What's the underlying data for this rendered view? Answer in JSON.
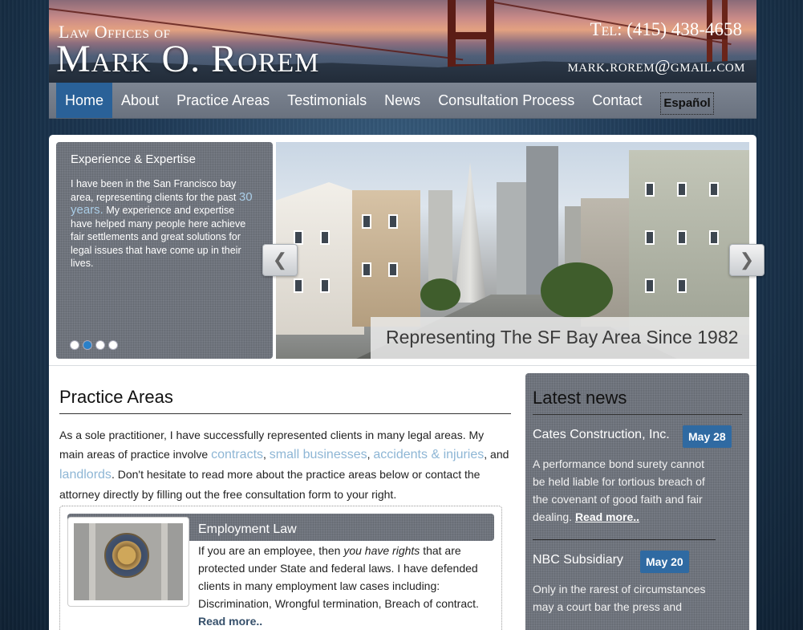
{
  "header": {
    "brand_top": "Law Offices of",
    "brand_name": "Mark O. Rorem",
    "phone": "Tel: (415) 438-4658",
    "email": "mark.rorem@gmail.com"
  },
  "nav": {
    "items": [
      {
        "label": "Home",
        "active": true
      },
      {
        "label": "About"
      },
      {
        "label": "Practice Areas"
      },
      {
        "label": "Testimonials"
      },
      {
        "label": "News"
      },
      {
        "label": "Consultation Process"
      },
      {
        "label": "Contact"
      }
    ],
    "language": "Español"
  },
  "slider": {
    "box_title": "Experience & Expertise",
    "box_text_1": "I have been in the San Francisco bay area, representing clients for the past",
    "box_highlight": "30 years.",
    "box_text_2": "My experience and expertise have helped many people here achieve fair settlements and great solutions for legal issues that have come up in their lives.",
    "caption": "Representing The SF Bay Area Since 1982",
    "prev_icon": "chevron-left",
    "next_icon": "chevron-right",
    "dots": 4,
    "active_dot": 1
  },
  "practice": {
    "title": "Practice Areas",
    "intro_1": "As a sole practitioner, I have successfully represented clients in many legal areas. My main areas of practice involve",
    "link_contracts": "contracts",
    "sep_1": ",",
    "link_small_business": "small businesses",
    "sep_2": ",",
    "link_accidents": "accidents & injuries",
    "sep_3": ", and",
    "link_landlords": "landlords",
    "intro_2": ". Don't hesitate to read more about the practice areas below or contact the attorney directly by filling out the free consultation form to your right.",
    "card": {
      "title": "Employment Law",
      "text_1": "If you are an employee, then",
      "text_em": "you have rights",
      "text_2": "that are protected under State and federal laws. I have defended clients in many employment law cases including: Discrimination, Wrongful termination, Breach of contract.",
      "read_more": "Read more.."
    }
  },
  "news": {
    "title": "Latest news",
    "items": [
      {
        "title": "Cates Construction, Inc.",
        "date": "May 28",
        "body": "A performance bond surety cannot be held liable for tortious breach of the covenant of good faith and fair dealing.",
        "read_more": "Read more.."
      },
      {
        "title": "NBC Subsidiary",
        "date": "May 20",
        "body": "Only in the rarest of circumstances may a court bar the press and"
      }
    ]
  },
  "colors": {
    "accent_blue": "#2a6198",
    "link_blue": "#8eb6d5",
    "date_badge": "#2f6aa2"
  }
}
